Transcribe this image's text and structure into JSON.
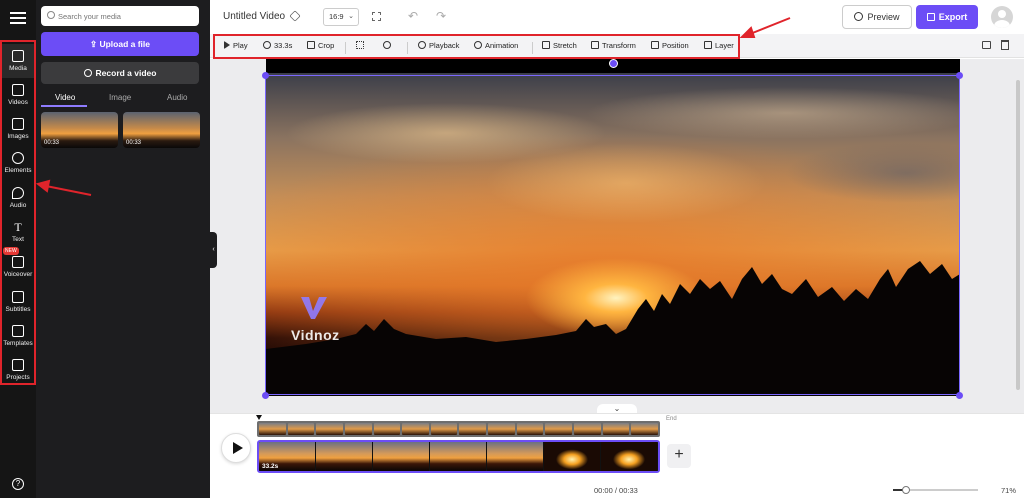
{
  "project": {
    "title": "Untitled Video",
    "aspect_ratio": "16:9"
  },
  "topbar": {
    "preview_label": "Preview",
    "export_label": "Export"
  },
  "rail": {
    "items": [
      {
        "label": "Media",
        "icon": "plus-box-icon"
      },
      {
        "label": "Videos",
        "icon": "play-box-icon"
      },
      {
        "label": "Images",
        "icon": "image-icon"
      },
      {
        "label": "Elements",
        "icon": "shapes-icon"
      },
      {
        "label": "Audio",
        "icon": "music-note-icon"
      },
      {
        "label": "Text",
        "icon": "text-t-icon"
      },
      {
        "label": "Voiceover",
        "icon": "voiceover-icon",
        "badge": "NEW"
      },
      {
        "label": "Subtitles",
        "icon": "subtitles-icon"
      },
      {
        "label": "Templates",
        "icon": "templates-icon"
      },
      {
        "label": "Projects",
        "icon": "folder-icon"
      }
    ],
    "help_icon": "help-circle-icon"
  },
  "media_panel": {
    "search_placeholder": "Search your media",
    "upload_label": "Upload a file",
    "record_label": "Record a video",
    "tabs": [
      "Video",
      "Image",
      "Audio"
    ],
    "active_tab": "Video",
    "thumbnails": [
      {
        "duration": "00:33"
      },
      {
        "duration": "00:33"
      }
    ]
  },
  "toolbar": {
    "play": "Play",
    "trim": "33.3s",
    "crop": "Crop",
    "playback": "Playback",
    "animation": "Animation",
    "stretch": "Stretch",
    "transform": "Transform",
    "position": "Position",
    "layer": "Layer"
  },
  "canvas": {
    "watermark": "Vidnoz"
  },
  "timeline": {
    "clip_duration": "33.2s",
    "end_label": "End",
    "timecode": "00:00 / 00:33",
    "zoom_percent": "71%",
    "zoom_level": 0.15
  },
  "colors": {
    "accent": "#6c4df6",
    "annotation": "#e0242b",
    "rail_bg": "#151515",
    "panel_bg": "#1d1d1f"
  }
}
